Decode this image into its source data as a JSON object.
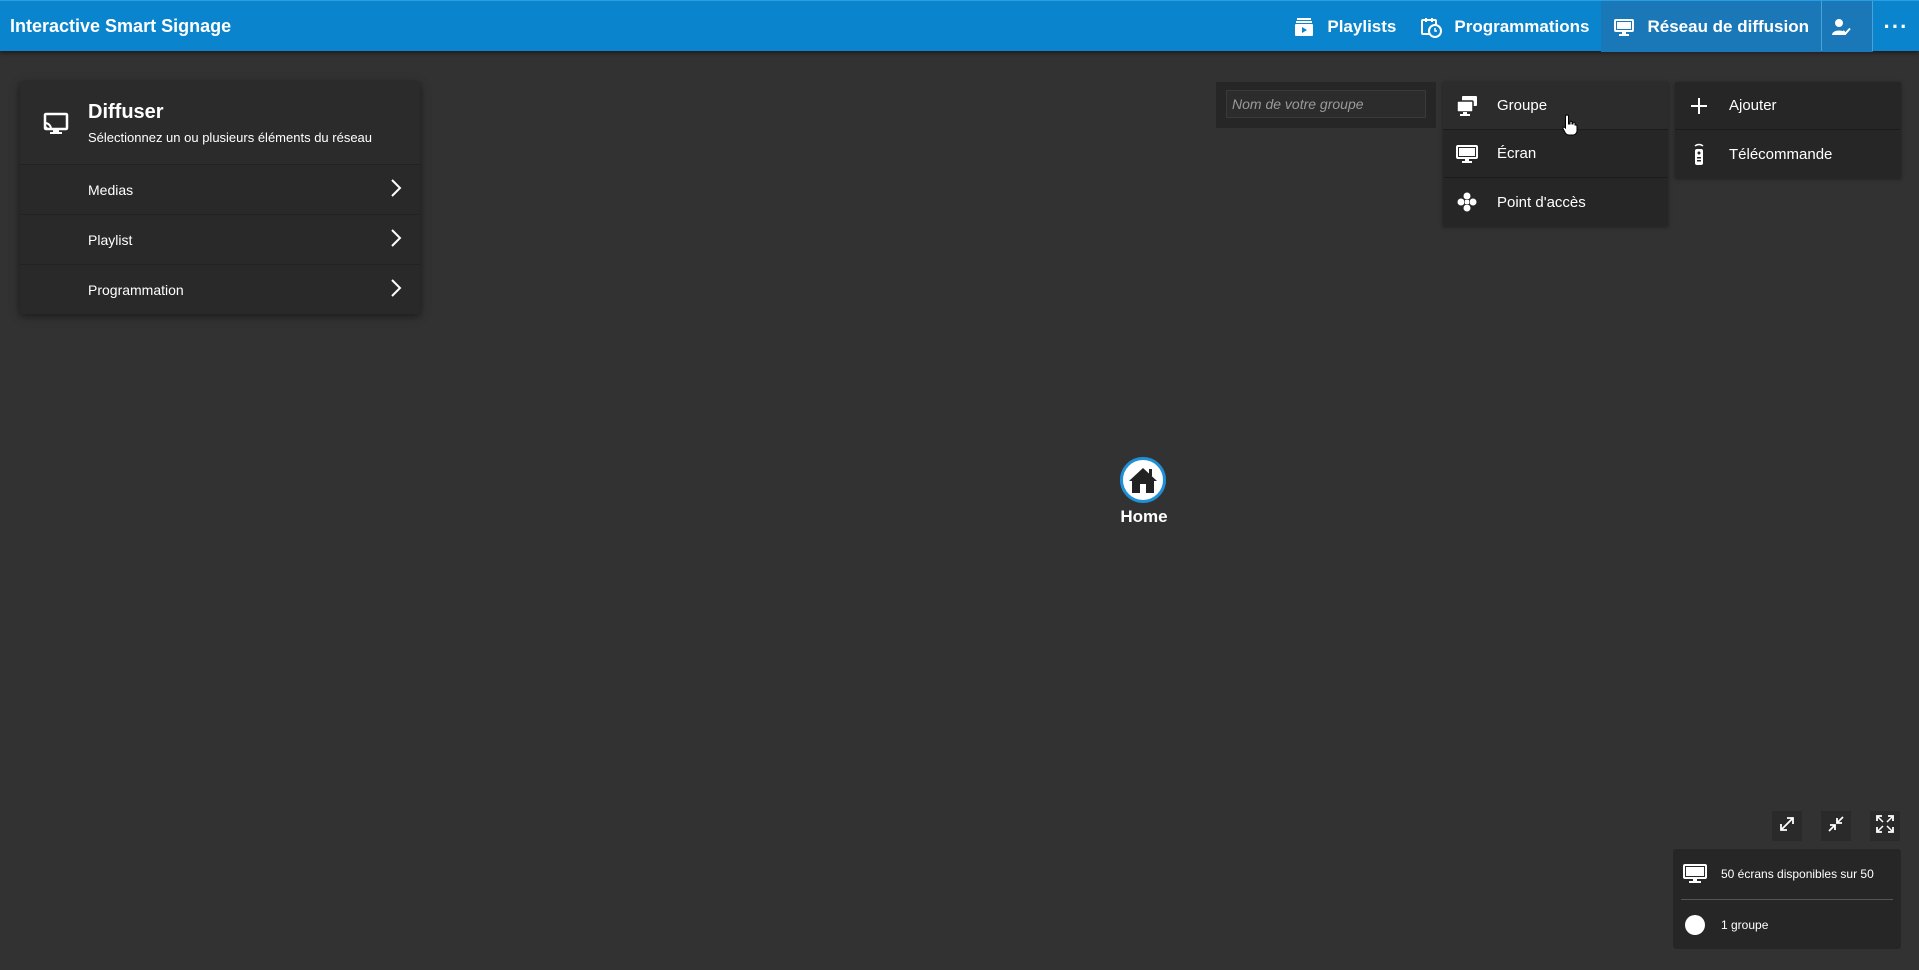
{
  "app": {
    "title": "Interactive Smart Signage"
  },
  "nav": {
    "items": [
      {
        "label": "Playlists",
        "icon": "playlist-icon",
        "active": false
      },
      {
        "label": "Programmations",
        "icon": "schedule-icon",
        "active": false
      },
      {
        "label": "Réseau de diffusion",
        "icon": "monitor-icon",
        "active": true
      }
    ],
    "user_icon": "user-check-icon",
    "more_label": "···"
  },
  "panel": {
    "title": "Diffuser",
    "subtitle": "Sélectionnez un ou plusieurs éléments du réseau",
    "icon": "cast-icon",
    "items": [
      {
        "label": "Medias"
      },
      {
        "label": "Playlist"
      },
      {
        "label": "Programmation"
      }
    ]
  },
  "group_input": {
    "placeholder": "Nom de votre groupe",
    "value": ""
  },
  "type_menu": {
    "items": [
      {
        "label": "Groupe",
        "icon": "group-screens-icon"
      },
      {
        "label": "Écran",
        "icon": "monitor-icon"
      },
      {
        "label": "Point d'accès",
        "icon": "access-point-icon"
      }
    ]
  },
  "add_menu": {
    "items": [
      {
        "label": "Ajouter",
        "icon": "plus-icon"
      },
      {
        "label": "Télécommande",
        "icon": "remote-icon"
      }
    ]
  },
  "node": {
    "label": "Home",
    "icon": "home-icon"
  },
  "info": {
    "screens": "50 écrans disponibles sur 50",
    "groups": "1 groupe"
  },
  "colors": {
    "topbar": "#0a84cd",
    "active_nav": "#1a78b9",
    "background": "#323232",
    "node_border": "#1f8fd6"
  }
}
